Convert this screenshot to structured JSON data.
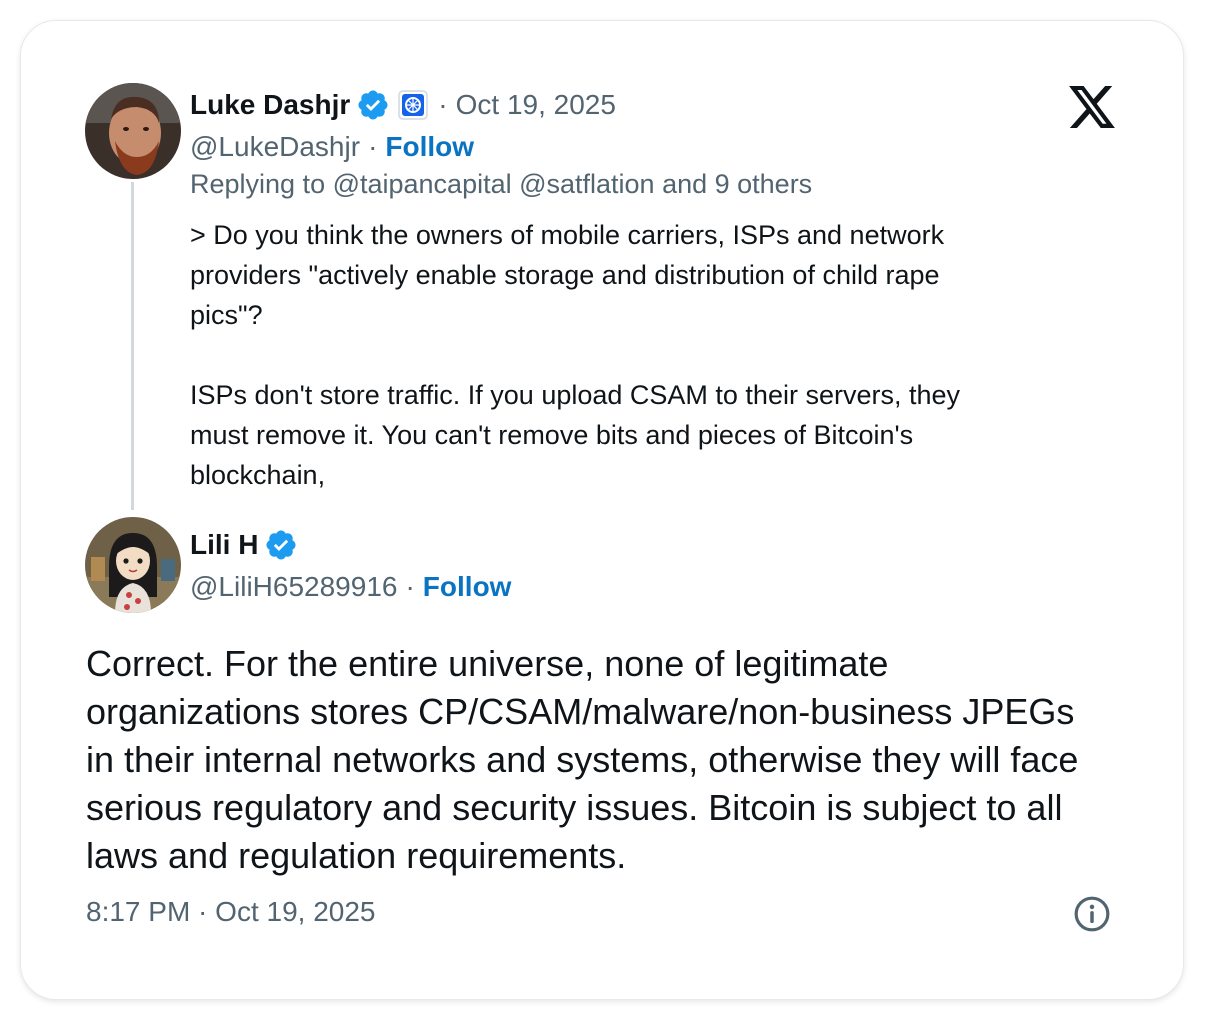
{
  "reply_tweet": {
    "author_name": "Luke Dashjr",
    "separator": "·",
    "date": "Oct 19, 2025",
    "handle": "@LukeDashjr",
    "follow_label": "Follow",
    "replying_to": "Replying to @taipancapital @satflation and 9 others",
    "body": "> Do you think the owners of mobile carriers, ISPs and network\nproviders \"actively enable storage and distribution of child rape\npics\"?\n\nISPs don't store traffic. If you upload CSAM to their servers, they\nmust remove it. You can't remove bits and pieces of Bitcoin's\nblockchain,"
  },
  "main_tweet": {
    "author_name": "Lili H",
    "separator": "·",
    "handle": "@LiliH65289916",
    "follow_label": "Follow",
    "body": "Correct. For the entire universe, none of legitimate organizations stores CP/CSAM/malware/non-business JPEGs in their internal networks and systems, otherwise they will face serious regulatory and security issues. Bitcoin is subject to all laws and regulation requirements.",
    "timestamp": "8:17 PM · Oct 19, 2025"
  },
  "icons": {
    "platform": "x-logo-icon",
    "verified": "verified-badge-icon",
    "affiliate": "affiliate-badge-icon",
    "info": "info-icon"
  },
  "colors": {
    "verified_blue": "#1d9bf0",
    "follow_blue": "#0a74c2",
    "muted_text": "#536471",
    "thread_line": "#cfd9de"
  }
}
